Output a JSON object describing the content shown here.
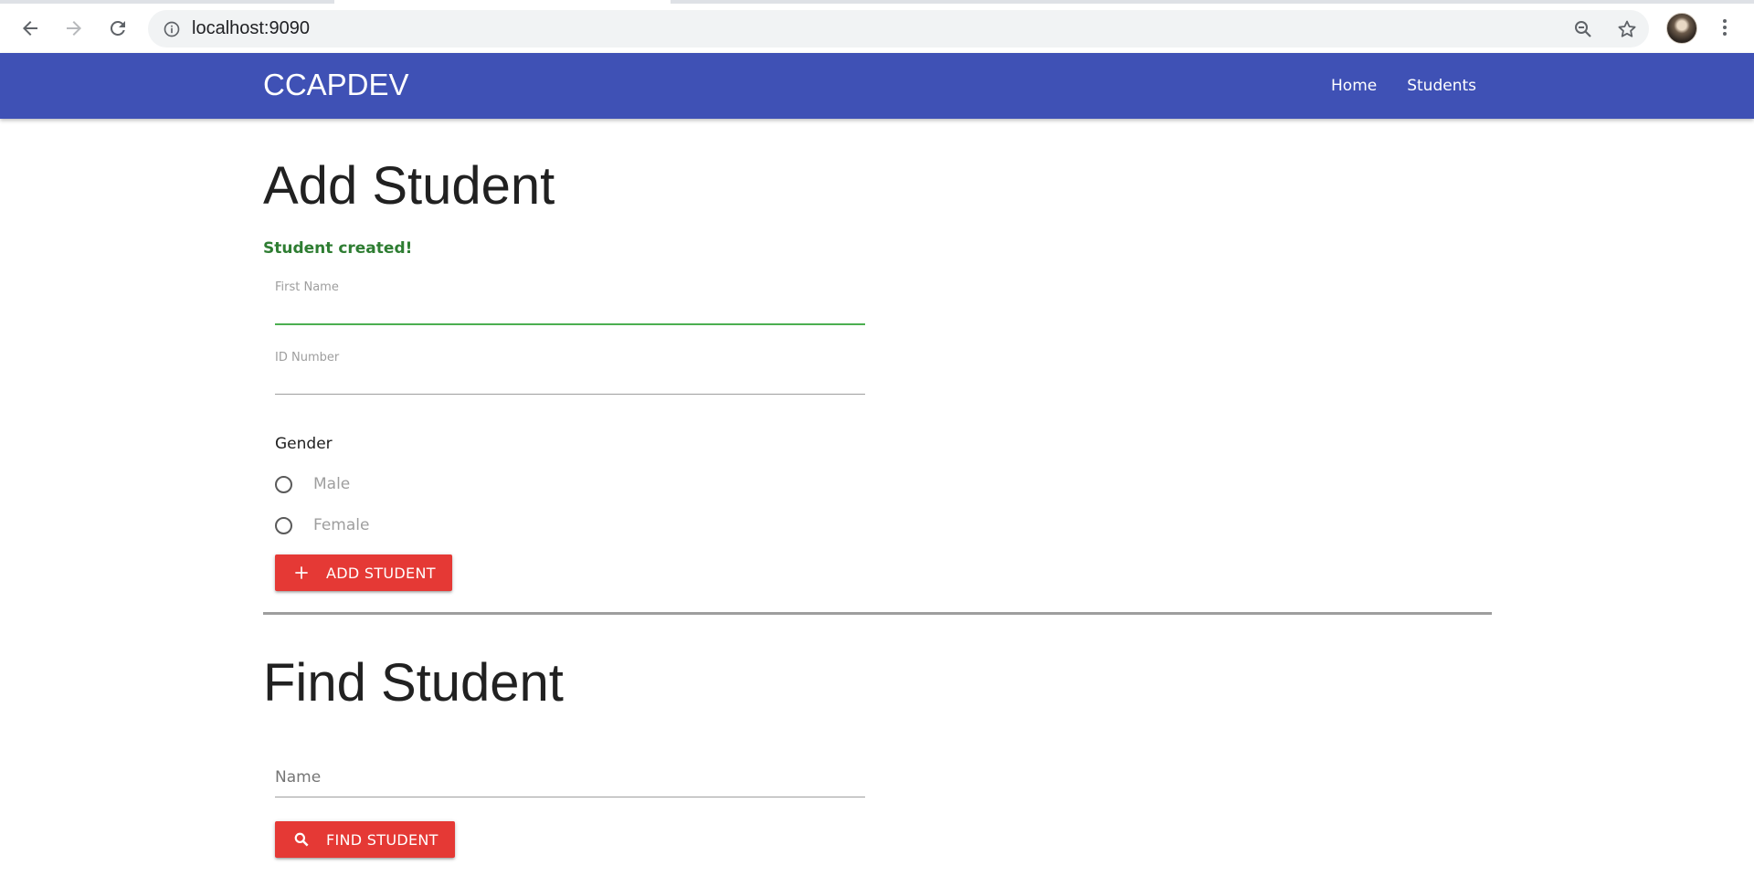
{
  "browser": {
    "url": "localhost:9090"
  },
  "navbar": {
    "brand": "CCAPDEV",
    "links": [
      "Home",
      "Students"
    ],
    "color": "#3f51b5"
  },
  "add_section": {
    "title": "Add Student",
    "status": "Student created!",
    "first_name": {
      "label": "First Name",
      "value": ""
    },
    "id_number": {
      "label": "ID Number",
      "value": ""
    },
    "gender": {
      "label": "Gender",
      "options": [
        "Male",
        "Female"
      ]
    },
    "button_label": "ADD STUDENT",
    "button_icon": "plus-icon"
  },
  "find_section": {
    "title": "Find Student",
    "name_placeholder": "Name",
    "button_label": "FIND STUDENT",
    "button_icon": "search-icon"
  },
  "colors": {
    "accent": "#e53935",
    "success": "#2e7d32"
  }
}
